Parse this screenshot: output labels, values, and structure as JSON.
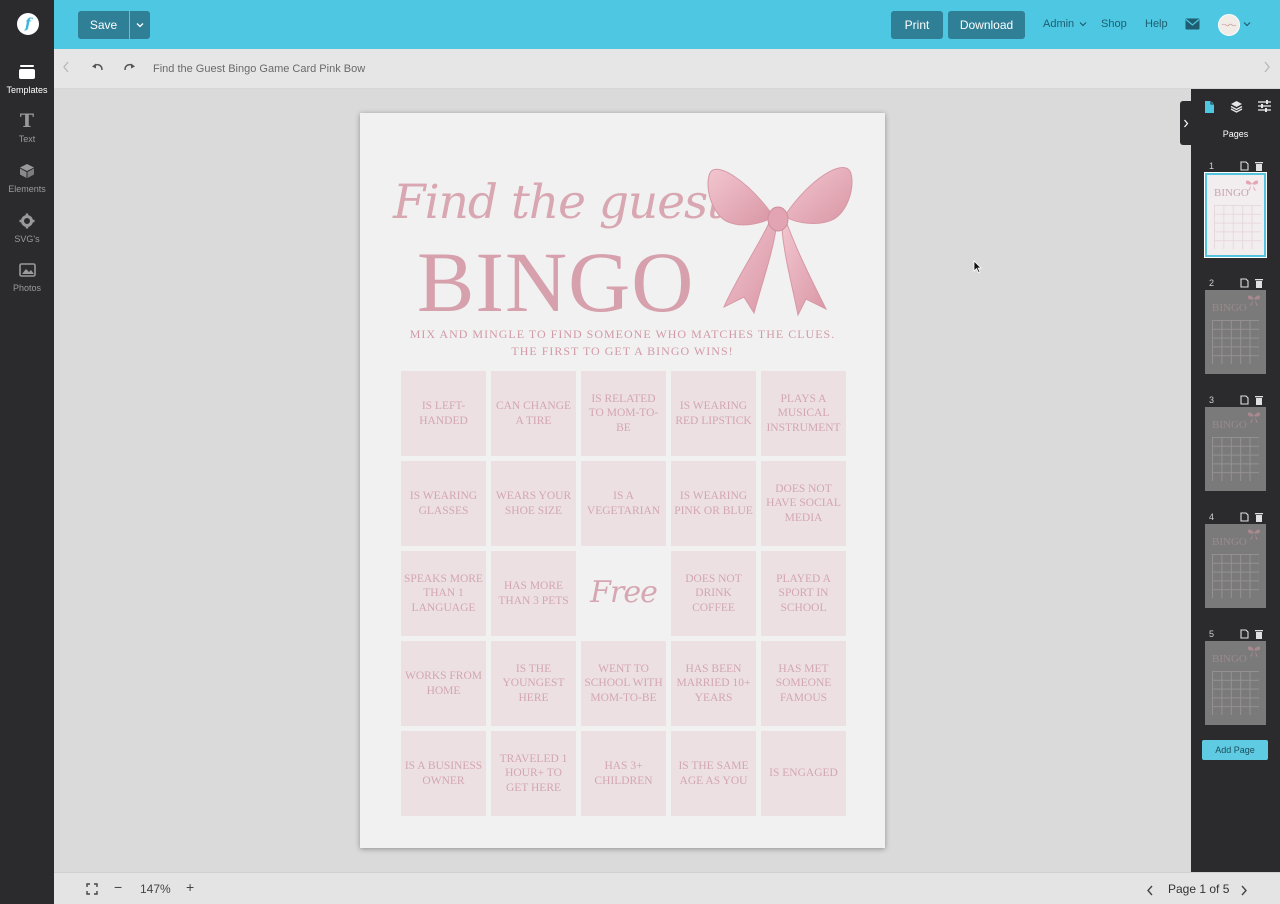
{
  "app": {
    "logo_letter": "f",
    "accent_color": "#4ec7e2",
    "dark_button_color": "#2f7f97"
  },
  "sidebar": {
    "items": [
      {
        "label": "Templates",
        "icon": "templates-icon",
        "active": true
      },
      {
        "label": "Text",
        "icon": "text-icon"
      },
      {
        "label": "Elements",
        "icon": "elements-icon"
      },
      {
        "label": "SVG's",
        "icon": "svg-icon"
      },
      {
        "label": "Photos",
        "icon": "photos-icon"
      }
    ]
  },
  "topbar": {
    "save_label": "Save",
    "print_label": "Print",
    "download_label": "Download",
    "admin_label": "Admin",
    "shop_label": "Shop",
    "help_label": "Help"
  },
  "subbar": {
    "doc_title": "Find the Guest Bingo Game Card Pink Bow"
  },
  "page": {
    "script_title": "Find the guest",
    "bingo_title": "BINGO",
    "subtitle_line1": "MIX AND MINGLE TO FIND SOMEONE WHO MATCHES THE CLUES.",
    "subtitle_line2": "THE FIRST TO GET A BINGO WINS!",
    "text_color": "#d6a0ac",
    "cells": [
      "IS LEFT-HANDED",
      "CAN CHANGE A TIRE",
      "IS RELATED TO MOM-TO-BE",
      "IS WEARING RED LIPSTICK",
      "PLAYS A MUSICAL INSTRUMENT",
      "IS WEARING GLASSES",
      "WEARS YOUR SHOE SIZE",
      "IS A VEGETARIAN",
      "IS WEARING PINK OR BLUE",
      "DOES NOT HAVE SOCIAL MEDIA",
      "SPEAKS MORE THAN 1 LANGUAGE",
      "HAS MORE THAN 3 PETS",
      "Free",
      "DOES NOT DRINK COFFEE",
      "PLAYED A SPORT IN SCHOOL",
      "WORKS FROM HOME",
      "IS THE YOUNGEST HERE",
      "WENT TO SCHOOL WITH MOM-TO-BE",
      "HAS BEEN MARRIED 10+ YEARS",
      "HAS MET SOMEONE FAMOUS",
      "IS A BUSINESS OWNER",
      "TRAVELED 1 HOUR+ TO GET HERE",
      "HAS 3+ CHILDREN",
      "IS THE SAME AGE AS YOU",
      "IS ENGAGED"
    ]
  },
  "right_panel": {
    "title": "Pages",
    "pages": [
      "1",
      "2",
      "3",
      "4",
      "5"
    ],
    "thumb_bingo": "BINGO",
    "add_page_label": "Add Page"
  },
  "bottombar": {
    "zoom_label": "147%",
    "page_indicator": "Page 1 of 5"
  }
}
